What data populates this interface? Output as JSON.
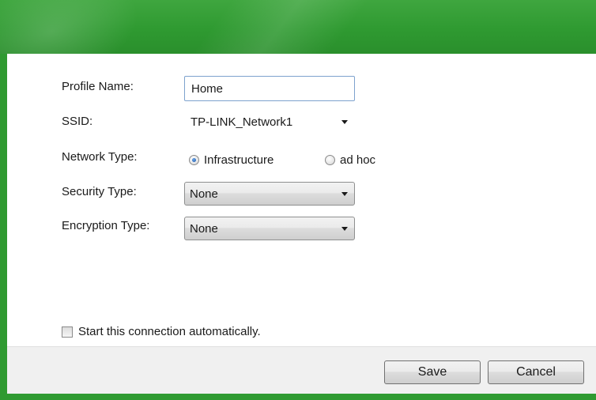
{
  "form": {
    "profile_name_label": "Profile Name:",
    "profile_name_value": "Home",
    "ssid_label": "SSID:",
    "ssid_value": "TP-LINK_Network1",
    "network_type_label": "Network Type:",
    "network_type_options": [
      {
        "label": "Infrastructure",
        "checked": true
      },
      {
        "label": "ad hoc",
        "checked": false
      }
    ],
    "security_type_label": "Security Type:",
    "security_type_value": "None",
    "encryption_type_label": "Encryption Type:",
    "encryption_type_value": "None",
    "auto_connect_label": "Start this connection automatically.",
    "auto_connect_checked": false
  },
  "buttons": {
    "save_label": "Save",
    "cancel_label": "Cancel"
  },
  "colors": {
    "banner_green": "#2f9a31",
    "input_border": "#7da2ce",
    "footer_bg": "#f0f0f0"
  },
  "icons": {
    "dropdown": "chevron-down-icon",
    "radio": "radio-icon",
    "checkbox": "checkbox-icon"
  }
}
